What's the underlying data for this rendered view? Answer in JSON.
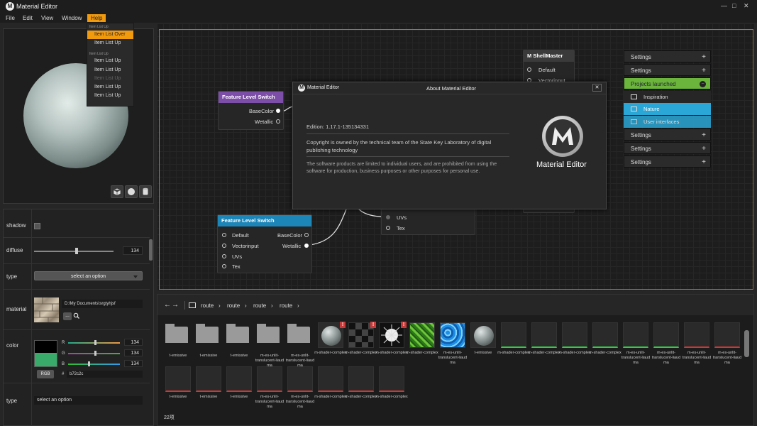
{
  "app": {
    "title": "Material Editor",
    "logo_letter": "M"
  },
  "window_controls": {
    "minimize": "—",
    "maximize": "□",
    "close": "✕"
  },
  "menu": [
    "File",
    "Edit",
    "View",
    "Window",
    "Help"
  ],
  "help_menu": {
    "header1": "Item List Up",
    "group1": [
      "Item List Over",
      "Item List Up"
    ],
    "header2": "Item List Up",
    "group2": [
      "Item List Up",
      "Item List Up",
      "Item List Up",
      "Item List Up",
      "Item List Up"
    ]
  },
  "properties": {
    "shadow": {
      "label": "shadow"
    },
    "diffuse": {
      "label": "diffuse",
      "value": "134",
      "slider_fraction": 0.53
    },
    "type1": {
      "label": "type",
      "placeholder": "select an option"
    },
    "material": {
      "label": "material",
      "path": "D:\\My Documents\\srgtyhjsf",
      "browse": "..."
    },
    "color": {
      "label": "color",
      "r_label": "R",
      "g_label": "G",
      "b_label": "B",
      "r": "134",
      "g": "134",
      "b": "134",
      "mode": "RGB",
      "hash": "#",
      "hex": "b72c2c",
      "swatch": "#3aaa6a"
    },
    "type2": {
      "label": "type",
      "placeholder": "select an option"
    }
  },
  "nodes": {
    "shell": {
      "title": "ShellMaster",
      "rows": [
        "Default",
        "Vectorinput"
      ]
    },
    "fls1": {
      "title": "Feature Level Switch",
      "outputs": [
        "BaseColor",
        "Wetallic"
      ]
    },
    "fls2": {
      "title": "Feature Level Switch",
      "inputs": [
        "Default",
        "Vectorinput",
        "UVs",
        "Tex"
      ],
      "outputs": [
        "BaseColor",
        "Wetallic"
      ]
    },
    "uvs": {
      "rows": [
        "UVs",
        "Tex"
      ]
    }
  },
  "settings_panel": {
    "rows": [
      "Settings",
      "Settings"
    ],
    "expanded": "Projects launched",
    "subs": [
      "Inspiration",
      "Nature",
      "User interfaces"
    ],
    "rows_after": [
      "Settings",
      "Settings",
      "Settings"
    ]
  },
  "about": {
    "title": "About Material Editor",
    "header_app": "Material Editor",
    "edition": "Edition: 1.17.1-135134331",
    "copyright": "Copyright is owned by the technical team of the State Key Laboratory of digital publishing technology",
    "license": "The software products are limited to individual users, and are prohibited from using the software for production, business purposes or other purposes for personal use.",
    "brand": "Material Editor"
  },
  "assets": {
    "breadcrumb": [
      "route",
      "route",
      "route",
      "route"
    ],
    "items": [
      {
        "label": "t-emissive",
        "kind": "folder"
      },
      {
        "label": "t-emissive",
        "kind": "folder"
      },
      {
        "label": "t-emissive",
        "kind": "folder"
      },
      {
        "label": "m-es-unlit-translucent-liaud ma",
        "kind": "folder"
      },
      {
        "label": "m-es-unlit-translucent-liaud ma",
        "kind": "folder"
      },
      {
        "label": "m-shader-complex",
        "kind": "sphere"
      },
      {
        "label": "m-shader-complex",
        "kind": "checker"
      },
      {
        "label": "m-shader-complex",
        "kind": "web"
      },
      {
        "label": "m-shader-complex",
        "kind": "grass"
      },
      {
        "label": "m-es-unlit-translucent-liaud ma",
        "kind": "water"
      },
      {
        "label": "t-emissive",
        "kind": "sphere2"
      },
      {
        "label": "m-shader-complex",
        "kind": "green"
      },
      {
        "label": "m-shader-complex",
        "kind": "green"
      },
      {
        "label": "m-shader-complex",
        "kind": "green"
      },
      {
        "label": "m-shader-complex",
        "kind": "green"
      },
      {
        "label": "m-es-unlit-translucent-liaud ma",
        "kind": "green"
      },
      {
        "label": "m-es-unlit-translucent-liaud ma",
        "kind": "green"
      },
      {
        "label": "m-es-unlit-translucent-liaud ma",
        "kind": "red"
      },
      {
        "label": "m-es-unlit-translucent-liaud ma",
        "kind": "red"
      },
      {
        "label": "t-emissive",
        "kind": "red"
      },
      {
        "label": "t-emissive",
        "kind": "red"
      },
      {
        "label": "t-emissive",
        "kind": "red"
      },
      {
        "label": "m-es-unlit-translucent-liaud ma",
        "kind": "red"
      },
      {
        "label": "m-es-unlit-translucent-liaud ma",
        "kind": "red"
      },
      {
        "label": "m-shader-complex",
        "kind": "red"
      },
      {
        "label": "m-shader-complex",
        "kind": "red"
      },
      {
        "label": "m-shader-complex",
        "kind": "red"
      }
    ],
    "count": "22项"
  },
  "colors": {
    "accent_orange": "#f29a0e",
    "selection_blue": "#2aa7d6",
    "expanded_green": "#6bb53c",
    "node_purple": "#7d4ea8",
    "node_blue": "#1d86b8"
  }
}
